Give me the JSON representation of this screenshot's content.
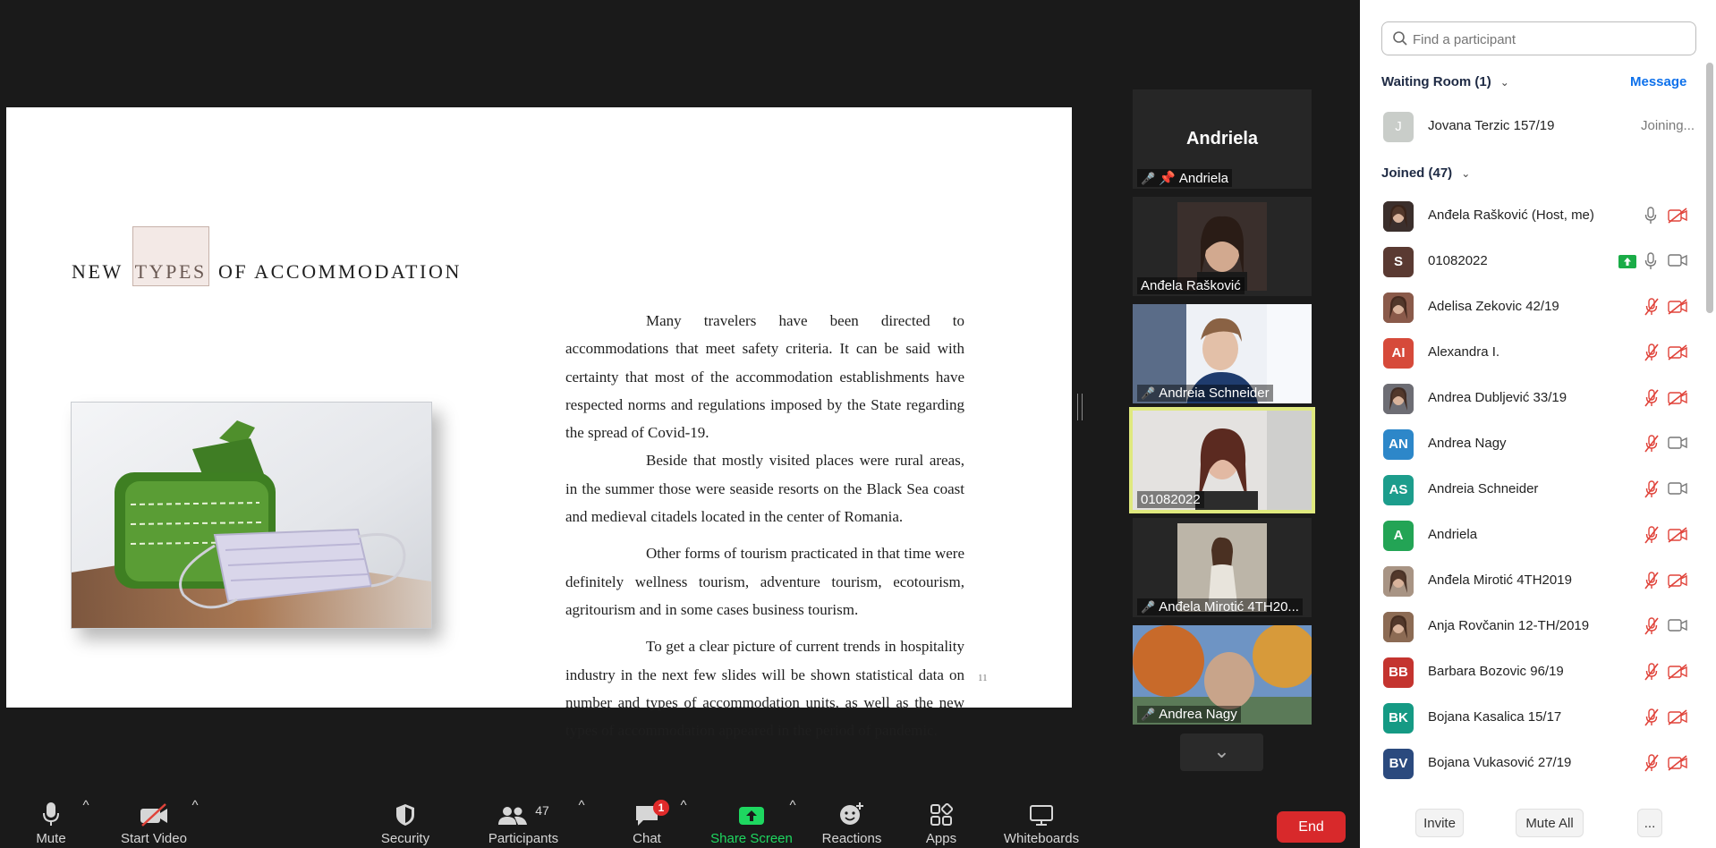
{
  "slide": {
    "title_before": "NEW ",
    "title_highlight": "TYPES",
    "title_after": " OF ACCOMMODATION",
    "paragraphs": [
      "Many travelers have been directed to accommodations that meet safety criteria. It can be said with certainty that most of the accommodation establishments have respected norms and regulations imposed by the State regarding the spread of Covid-19.",
      "Beside that mostly visited places were rural areas, in the summer those were seaside resorts on the Black Sea coast and medieval citadels located in the center of Romania.",
      "Other forms of tourism practicated in that time were definitely wellness tourism, adventure tourism, ecotourism, agritourism and in some cases business tourism.",
      "To get a clear picture of current trends in hospitality industry in the next few slides will be shown statistical data on number and types of accommodation units, as well as the new types of accommodation appeared in the period of pandemic."
    ],
    "page_number": "11"
  },
  "gallery": {
    "tiles": [
      {
        "name": "Andriela",
        "big_name": "Andriela",
        "muted": true,
        "pinned": true
      },
      {
        "name": "Anđela Rašković",
        "muted": false
      },
      {
        "name": "Andreia Schneider",
        "muted": true
      },
      {
        "name": "01082022",
        "muted": false,
        "speaking": true
      },
      {
        "name": "Anđela Mirotić 4TH20...",
        "muted": true
      },
      {
        "name": "Andrea Nagy",
        "muted": true
      }
    ]
  },
  "toolbar": {
    "mute": "Mute",
    "start_video": "Start Video",
    "security": "Security",
    "participants": "Participants",
    "participants_count": "47",
    "chat": "Chat",
    "chat_badge": "1",
    "share_screen": "Share Screen",
    "reactions": "Reactions",
    "apps": "Apps",
    "whiteboards": "Whiteboards",
    "end": "End"
  },
  "panel": {
    "search_placeholder": "Find a participant",
    "waiting_room_header": "Waiting Room (1)",
    "message_link": "Message",
    "waiting": {
      "initial": "J",
      "name": "Jovana Terzic 157/19",
      "status": "Joining..."
    },
    "joined_header": "Joined (47)",
    "participants": [
      {
        "name": "Anđela Rašković (Host, me)",
        "initials": "",
        "color": "#3b2f2c",
        "photo": true,
        "mic": "on",
        "cam": "off"
      },
      {
        "name": "01082022",
        "initials": "S",
        "color": "#5a3a32",
        "photo": false,
        "mic": "on",
        "cam": "on",
        "sharing": true
      },
      {
        "name": "Adelisa Zekovic 42/19",
        "initials": "",
        "color": "#8a5a4a",
        "photo": true,
        "mic": "off",
        "cam": "off"
      },
      {
        "name": "Alexandra I.",
        "initials": "AI",
        "color": "#d64a3a",
        "photo": false,
        "mic": "off",
        "cam": "off"
      },
      {
        "name": "Andrea Dubljević 33/19",
        "initials": "",
        "color": "#6d6d74",
        "photo": true,
        "mic": "off",
        "cam": "off"
      },
      {
        "name": "Andrea Nagy",
        "initials": "AN",
        "color": "#2d87c9",
        "photo": false,
        "mic": "off",
        "cam": "on"
      },
      {
        "name": "Andreia Schneider",
        "initials": "AS",
        "color": "#1c9d8c",
        "photo": false,
        "mic": "off",
        "cam": "on"
      },
      {
        "name": "Andriela",
        "initials": "A",
        "color": "#23a455",
        "photo": false,
        "mic": "off",
        "cam": "off"
      },
      {
        "name": "Anđela Mirotić 4TH2019",
        "initials": "",
        "color": "#a89484",
        "photo": true,
        "mic": "off",
        "cam": "off"
      },
      {
        "name": "Anja Rovčanin 12-TH/2019",
        "initials": "",
        "color": "#8c6b54",
        "photo": true,
        "mic": "off",
        "cam": "on"
      },
      {
        "name": "Barbara Bozovic 96/19",
        "initials": "BB",
        "color": "#c4342f",
        "photo": false,
        "mic": "off",
        "cam": "off"
      },
      {
        "name": "Bojana Kasalica 15/17",
        "initials": "BK",
        "color": "#159a84",
        "photo": false,
        "mic": "off",
        "cam": "off"
      },
      {
        "name": "Bojana Vukasović  27/19",
        "initials": "BV",
        "color": "#2b4a7e",
        "photo": false,
        "mic": "off",
        "cam": "off"
      }
    ],
    "invite": "Invite",
    "mute_all": "Mute All",
    "more": "..."
  }
}
